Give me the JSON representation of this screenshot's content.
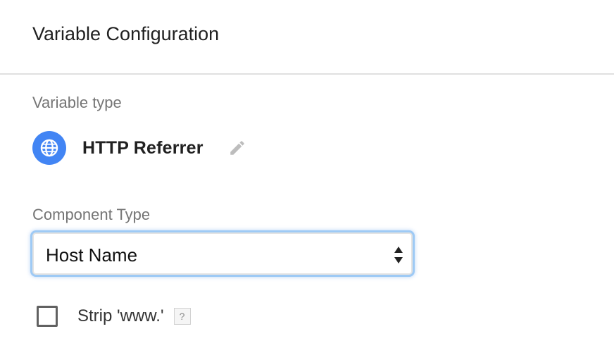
{
  "header": {
    "title": "Variable Configuration"
  },
  "variable_type": {
    "label": "Variable type",
    "name": "HTTP Referrer",
    "icon": "globe-icon",
    "icon_color": "#4285f4",
    "edit_icon": "pencil-icon"
  },
  "component_type": {
    "label": "Component Type",
    "selected": "Host Name"
  },
  "strip_www": {
    "label": "Strip 'www.'",
    "checked": false,
    "help": "?"
  }
}
